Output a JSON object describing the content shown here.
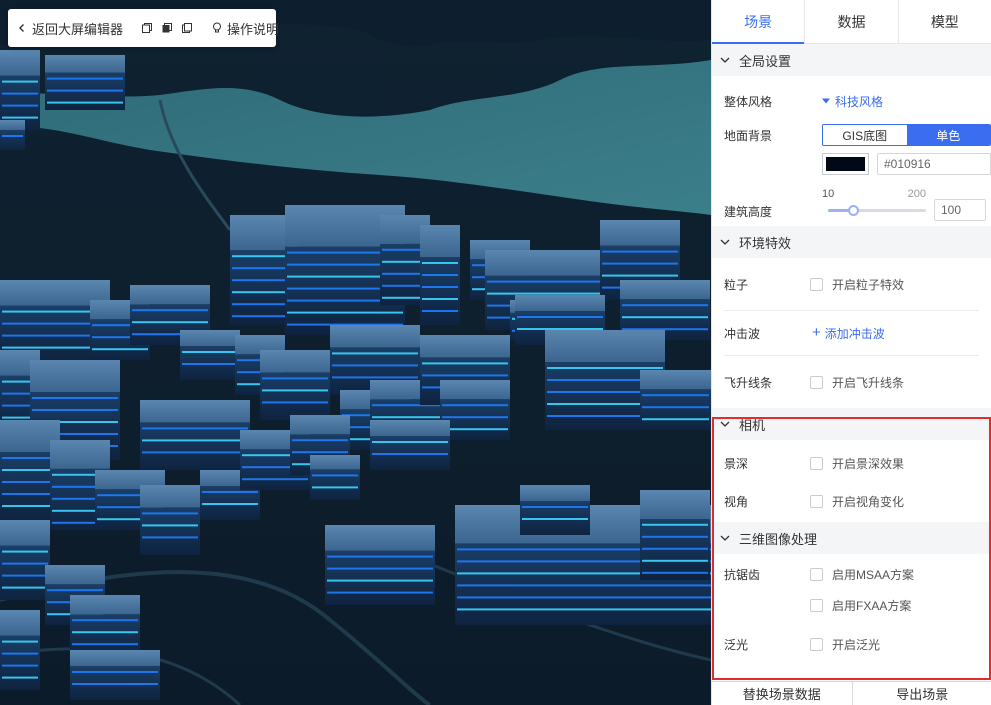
{
  "toolbar": {
    "back_label": "返回大屏编辑器",
    "help_label": "操作说明",
    "icons": [
      "back-icon",
      "layer-copy-icon",
      "layer-stack-icon",
      "layer-paste-icon",
      "bulb-icon"
    ]
  },
  "tabs": [
    {
      "label": "场景",
      "active": true
    },
    {
      "label": "数据",
      "active": false
    },
    {
      "label": "模型",
      "active": false
    }
  ],
  "global": {
    "title": "全局设置",
    "style_label": "整体风格",
    "style_value": "科技风格",
    "ground_label": "地面背景",
    "ground_options": [
      "GIS底图",
      "单色"
    ],
    "ground_selected": "单色",
    "color_value": "#010916",
    "height_label": "建筑高度",
    "height_min": "10",
    "height_max": "200",
    "height_value": "100",
    "height_fraction": 0.25
  },
  "env": {
    "title": "环境特效",
    "particle_label": "粒子",
    "particle_option": "开启粒子特效",
    "wave_label": "冲击波",
    "wave_action": "添加冲击波",
    "flyline_label": "飞升线条",
    "flyline_option": "开启飞升线条"
  },
  "camera": {
    "title": "相机",
    "dof_label": "景深",
    "dof_option": "开启景深效果",
    "view_label": "视角",
    "view_option": "开启视角变化"
  },
  "image": {
    "title": "三维图像处理",
    "aa_label": "抗锯齿",
    "msaa_option": "启用MSAA方案",
    "fxaa_option": "启用FXAA方案",
    "bloom_label": "泛光",
    "bloom_option": "开启泛光"
  },
  "footer": {
    "replace_label": "替换场景数据",
    "export_label": "导出场景"
  },
  "colors": {
    "accent": "#3a6df0",
    "highlight": "#e32d2d",
    "ground": "#010916"
  }
}
